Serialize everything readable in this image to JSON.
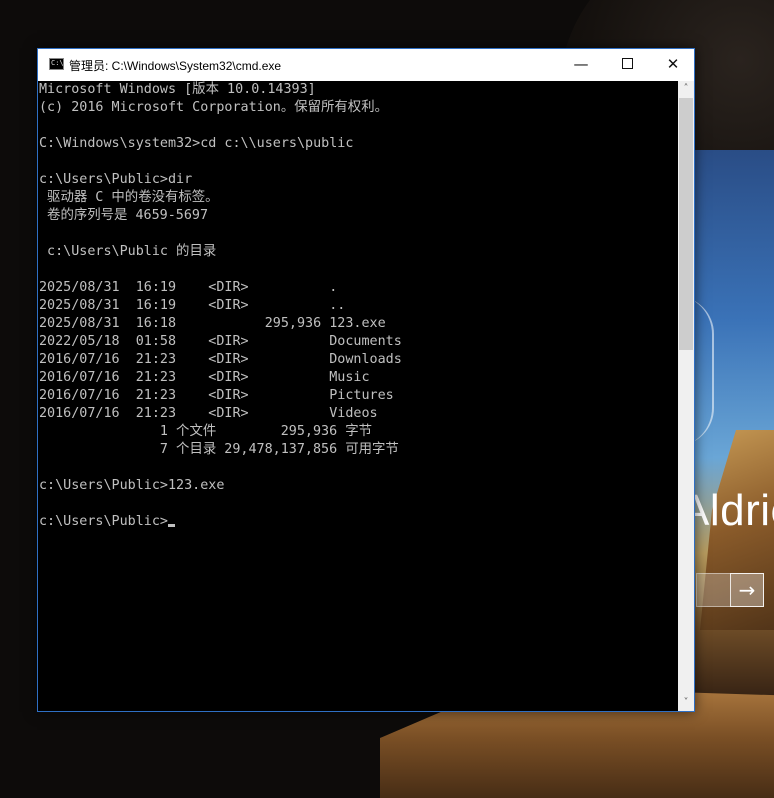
{
  "background": {
    "login_name": "Aldric",
    "submit_icon": "arrow-right-icon",
    "submit_glyph": "→"
  },
  "window": {
    "title": "管理员: C:\\Windows\\System32\\cmd.exe",
    "app_icon": "console-icon",
    "app_icon_glyph": "C:\\",
    "minimize_icon": "minimize-icon",
    "minimize_glyph": "—",
    "maximize_icon": "maximize-icon",
    "close_icon": "close-icon",
    "close_glyph": "✕"
  },
  "console": {
    "lines": [
      "Microsoft Windows [版本 10.0.14393]",
      "(c) 2016 Microsoft Corporation。保留所有权利。",
      "",
      "C:\\Windows\\system32>cd c:\\\\users\\public",
      "",
      "c:\\Users\\Public>dir",
      " 驱动器 C 中的卷没有标签。",
      " 卷的序列号是 4659-5697",
      "",
      " c:\\Users\\Public 的目录",
      "",
      "2025/08/31  16:19    <DIR>          .",
      "2025/08/31  16:19    <DIR>          ..",
      "2025/08/31  16:18           295,936 123.exe",
      "2022/05/18  01:58    <DIR>          Documents",
      "2016/07/16  21:23    <DIR>          Downloads",
      "2016/07/16  21:23    <DIR>          Music",
      "2016/07/16  21:23    <DIR>          Pictures",
      "2016/07/16  21:23    <DIR>          Videos",
      "               1 个文件        295,936 字节",
      "               7 个目录 29,478,137,856 可用字节",
      "",
      "c:\\Users\\Public>123.exe",
      "",
      "c:\\Users\\Public>"
    ],
    "text_color": "#c0c0c0",
    "background_color": "#000000"
  },
  "scrollbar": {
    "up_glyph": "˄",
    "down_glyph": "˅",
    "up_icon": "scroll-up-arrow-icon",
    "down_icon": "scroll-down-arrow-icon"
  }
}
